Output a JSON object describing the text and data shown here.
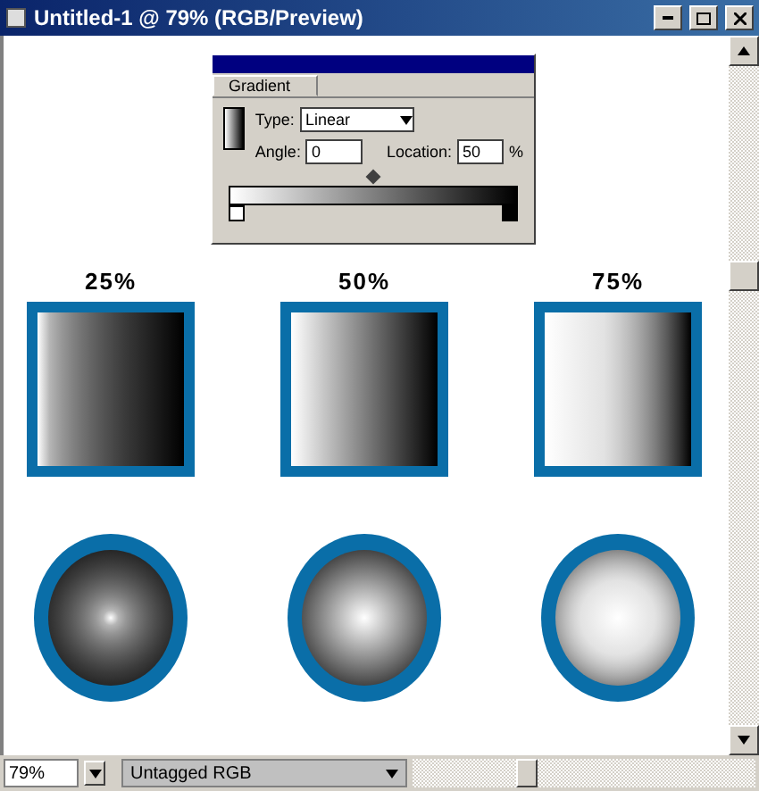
{
  "window": {
    "title": "Untitled-1 @ 79% (RGB/Preview)"
  },
  "gradient_palette": {
    "tab": "Gradient",
    "type_label": "Type:",
    "type_value": "Linear",
    "angle_label": "Angle:",
    "angle_value": "0",
    "location_label": "Location:",
    "location_value": "50",
    "percent": "%",
    "midpoint": {
      "level": 0.5
    }
  },
  "samples": [
    {
      "label": "25%",
      "kind": "dark"
    },
    {
      "label": "50%",
      "kind": "medium"
    },
    {
      "label": "75%",
      "kind": "light"
    }
  ],
  "status_bar": {
    "zoom": "79%",
    "profile": "Untagged RGB"
  }
}
